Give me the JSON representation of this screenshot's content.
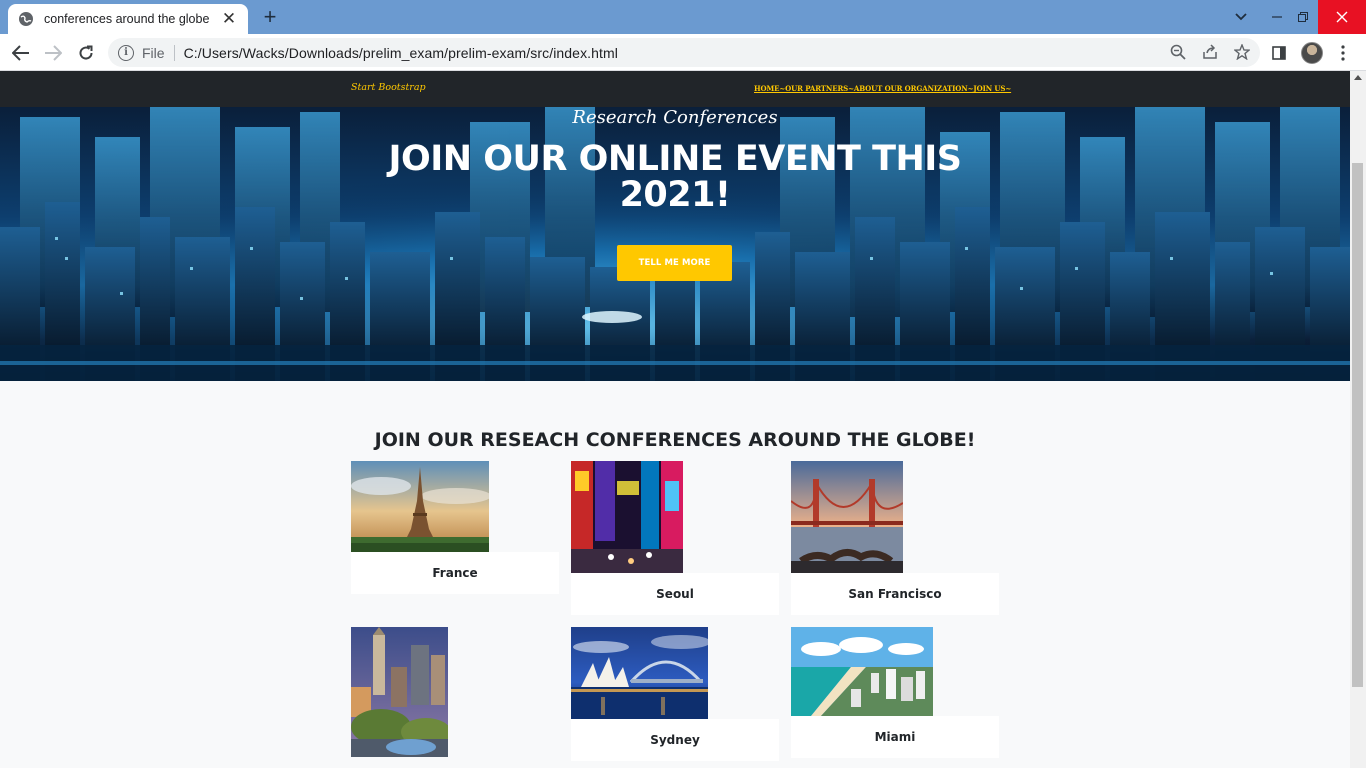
{
  "browser": {
    "tab_title": "conferences around the globe",
    "tab_close": "✕",
    "new_tab": "+",
    "omnibox_scheme": "File",
    "omnibox_url": "C:/Users/Wacks/Downloads/prelim_exam/prelim-exam/src/index.html"
  },
  "site": {
    "brand": "Start Bootstrap",
    "nav_links": "HOME~OUR PARTNERS~ABOUT OUR ORGANIZATION~JOIN US~"
  },
  "hero": {
    "subheading": "Research Conferences",
    "heading": "JOIN OUR ONLINE EVENT THIS 2021!",
    "button": "TELL ME MORE"
  },
  "conferences": {
    "title": "JOIN OUR RESEACH CONFERENCES AROUND THE GLOBE!",
    "cards": [
      {
        "label": "France"
      },
      {
        "label": "Seoul"
      },
      {
        "label": "San Francisco"
      },
      {
        "label": ""
      },
      {
        "label": "Sydney"
      },
      {
        "label": "Miami"
      }
    ]
  },
  "colors": {
    "accent": "#ffc800",
    "navbar": "#212529",
    "tabbar": "#6b9ad0",
    "close": "#e81123"
  }
}
